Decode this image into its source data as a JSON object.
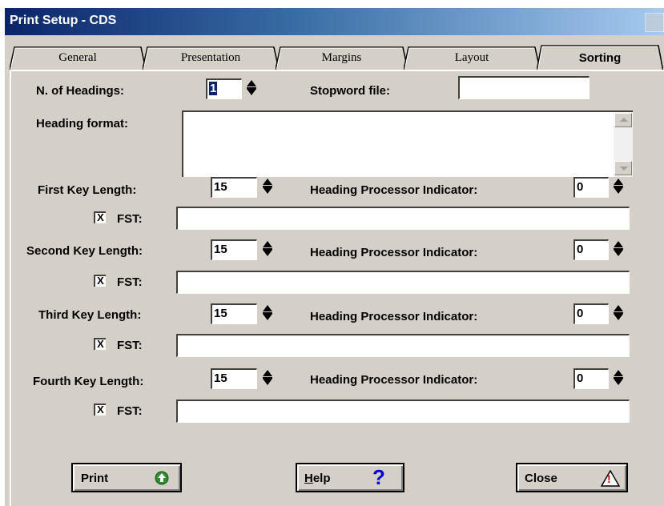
{
  "window": {
    "title": "Print Setup - CDS"
  },
  "tabs": [
    {
      "label": "General"
    },
    {
      "label": "Presentation"
    },
    {
      "label": "Margins"
    },
    {
      "label": "Layout"
    },
    {
      "label": "Sorting",
      "active": true
    }
  ],
  "form": {
    "num_headings_label": "N. of Headings:",
    "num_headings_value": "1",
    "stopword_label": "Stopword file:",
    "stopword_value": "",
    "heading_format_label": "Heading format:",
    "heading_format_value": "",
    "keys": [
      {
        "label": "First Key Length:",
        "length": "15",
        "hpi_label": "Heading Processor Indicator:",
        "hpi": "0",
        "fst_checked": "X",
        "fst_label": "FST:",
        "fst_value": ""
      },
      {
        "label": "Second Key Length:",
        "length": "15",
        "hpi_label": "Heading Processor Indicator:",
        "hpi": "0",
        "fst_checked": "X",
        "fst_label": "FST:",
        "fst_value": ""
      },
      {
        "label": "Third Key Length:",
        "length": "15",
        "hpi_label": "Heading Processor Indicator:",
        "hpi": "0",
        "fst_checked": "X",
        "fst_label": "FST:",
        "fst_value": ""
      },
      {
        "label": "Fourth Key Length:",
        "length": "15",
        "hpi_label": "Heading Processor Indicator:",
        "hpi": "0",
        "fst_checked": "X",
        "fst_label": "FST:",
        "fst_value": ""
      }
    ]
  },
  "buttons": {
    "print": "Print",
    "help_accel": "H",
    "help_rest": "elp",
    "help_glyph": "?",
    "close": "Close",
    "close_glyph": "!"
  },
  "colors": {
    "title_start": "#0a246a",
    "title_end": "#a6caf0",
    "face": "#d4d0c8",
    "print_icon": "#2e8b2e",
    "help_icon": "#0000cc",
    "close_icon": "#cc0000"
  }
}
